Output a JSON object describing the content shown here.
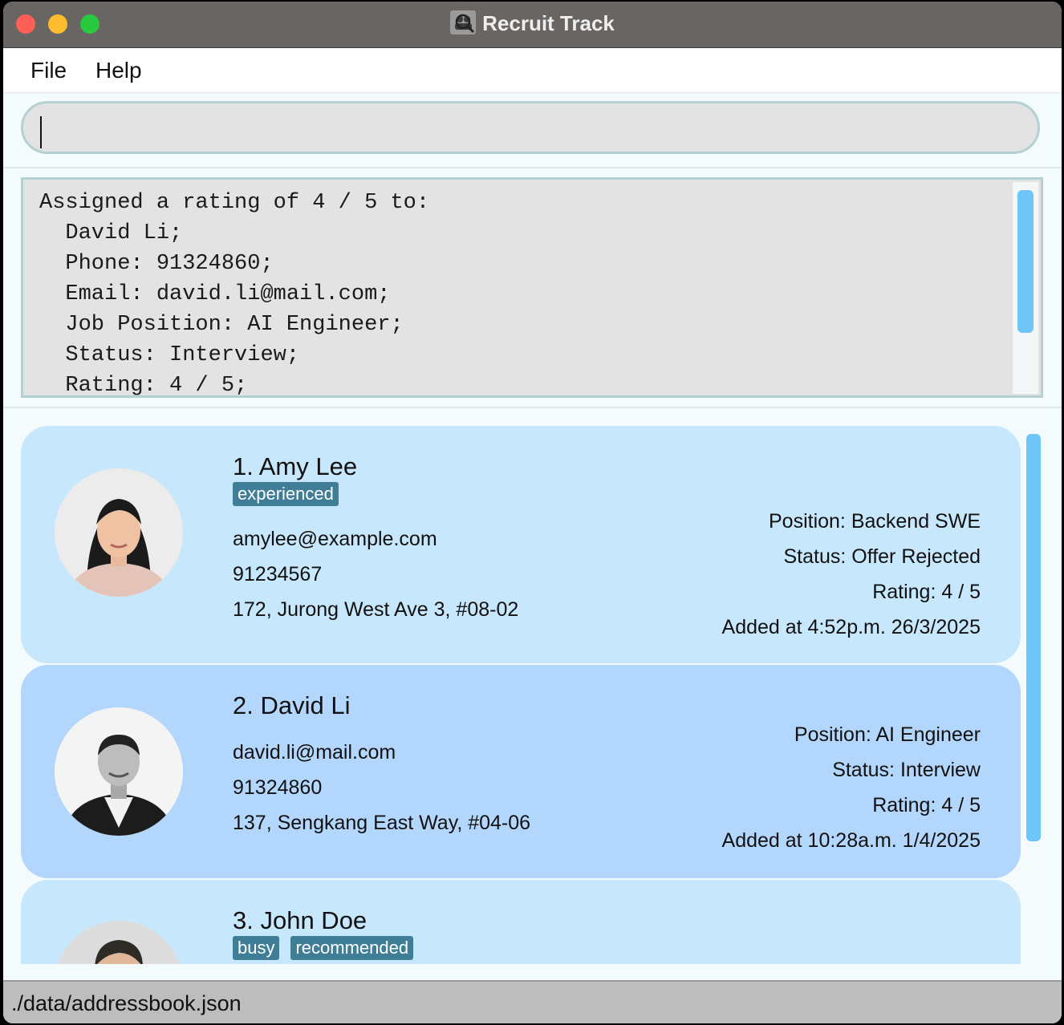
{
  "window": {
    "title": "Recruit Track",
    "icon": "magnifier-people-icon"
  },
  "menu": {
    "file": "File",
    "help": "Help"
  },
  "command": {
    "value": "",
    "placeholder": ""
  },
  "result": {
    "text": "Assigned a rating of 4 / 5 to:\n  David Li;\n  Phone: 91324860;\n  Email: david.li@mail.com;\n  Job Position: AI Engineer;\n  Status: Interview;\n  Rating: 4 / 5;"
  },
  "candidates": [
    {
      "name": "1. Amy Lee",
      "tags": [
        "experienced"
      ],
      "email": "amylee@example.com",
      "phone": "91234567",
      "address": "172, Jurong West Ave 3, #08-02",
      "position": "Position:  Backend SWE",
      "status": "Status:  Offer Rejected",
      "rating": "Rating:  4 / 5",
      "added": "Added at 4:52p.m. 26/3/2025"
    },
    {
      "name": "2. David Li",
      "tags": [],
      "email": "david.li@mail.com",
      "phone": "91324860",
      "address": "137, Sengkang East Way, #04-06",
      "position": "Position:  AI Engineer",
      "status": "Status:  Interview",
      "rating": "Rating:  4 / 5",
      "added": "Added at 10:28a.m. 1/4/2025"
    },
    {
      "name": "3. John Doe",
      "tags": [
        "busy",
        "recommended"
      ]
    }
  ],
  "status_bar": {
    "path": "./data/addressbook.json"
  },
  "colors": {
    "card_default": "#c7e7fc",
    "card_selected": "#b3d6fc",
    "tag": "#3f7e96",
    "scroll_thumb": "#6ec6f8",
    "titlebar": "#686563"
  }
}
